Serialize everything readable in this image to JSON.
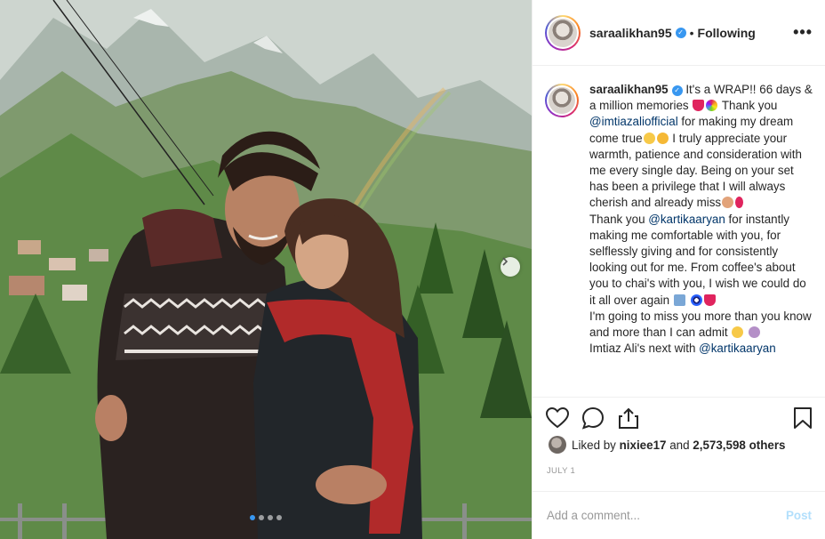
{
  "post": {
    "username": "saraalikhan95",
    "separator": "•",
    "follow_state": "Following",
    "more_label": "•••"
  },
  "caption": {
    "username": "saraalikhan95",
    "t1": "It's a WRAP!! 66 days & a million memories",
    "t2": "Thank you",
    "mention1": "@imtiazaliofficial",
    "t3": "for making my dream come true",
    "t4": "I truly appreciate your warmth, patience and consideration with me every single day. Being on your set has been a privilege that I will always cherish and already miss",
    "t5": "Thank you",
    "mention2": "@kartikaaryan",
    "t6": "for instantly making me comfortable with you, for selflessly giving and for consistently looking out for me. From coffee's about you to chai's with you, I wish we could do it all over again",
    "t7": "I'm going to miss you more than you know and more than I can admit",
    "t8": "Imtiaz Ali's next with",
    "mention3": "@kartikaaryan"
  },
  "likes": {
    "prefix": "Liked by",
    "user": "nixiee17",
    "joiner": "and",
    "count_text": "2,573,598 others"
  },
  "date": "JULY 1",
  "comment": {
    "placeholder": "Add a comment...",
    "post_label": "Post"
  },
  "icons": {
    "verified": "verified-badge-icon",
    "next": "chevron-right-icon",
    "like": "heart-icon",
    "comment": "comment-bubble-icon",
    "share": "share-icon",
    "save": "bookmark-icon"
  },
  "carousel": {
    "slides": 4,
    "active": 1
  },
  "colors": {
    "link": "#003569",
    "verified": "#3897f0",
    "post_disabled": "#b2dffc",
    "muted": "#999999"
  }
}
